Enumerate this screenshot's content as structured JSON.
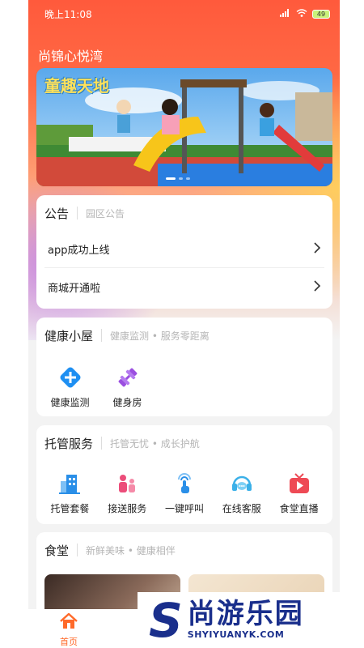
{
  "status_bar": {
    "time": "晚上11:08",
    "battery": "49"
  },
  "app_title": "尚锦心悦湾",
  "banner": {
    "title": "童趣天地"
  },
  "notice": {
    "title": "公告",
    "subtitle": "园区公告",
    "items": [
      {
        "label": "app成功上线"
      },
      {
        "label": "商城开通啦"
      }
    ]
  },
  "health": {
    "title": "健康小屋",
    "subtitle": "健康监测 • 服务零距离",
    "items": [
      {
        "label": "健康监测",
        "icon": "plus-diamond-icon",
        "color": "#1e8ff2"
      },
      {
        "label": "健身房",
        "icon": "dumbbell-icon",
        "color": "#9b4fe0"
      }
    ]
  },
  "care": {
    "title": "托管服务",
    "subtitle": "托管无忧 • 成长护航",
    "items": [
      {
        "label": "托管套餐",
        "icon": "building-icon",
        "color": "#2a8fe8"
      },
      {
        "label": "接送服务",
        "icon": "family-icon",
        "color": "#ec4d7a"
      },
      {
        "label": "一键呼叫",
        "icon": "tap-icon",
        "color": "#2a8fe8"
      },
      {
        "label": "在线客服",
        "icon": "headset-icon",
        "color": "#3bb0e8"
      },
      {
        "label": "食堂直播",
        "icon": "tv-icon",
        "color": "#ee4a55"
      }
    ]
  },
  "canteen": {
    "title": "食堂",
    "subtitle": "新鲜美味 • 健康相伴"
  },
  "tabbar": {
    "home_label": "首页",
    "accent": "#ff6a2a"
  },
  "watermark": {
    "text": "尚游乐园",
    "url": "SHYIYUANYK.COM",
    "letter": "S"
  }
}
